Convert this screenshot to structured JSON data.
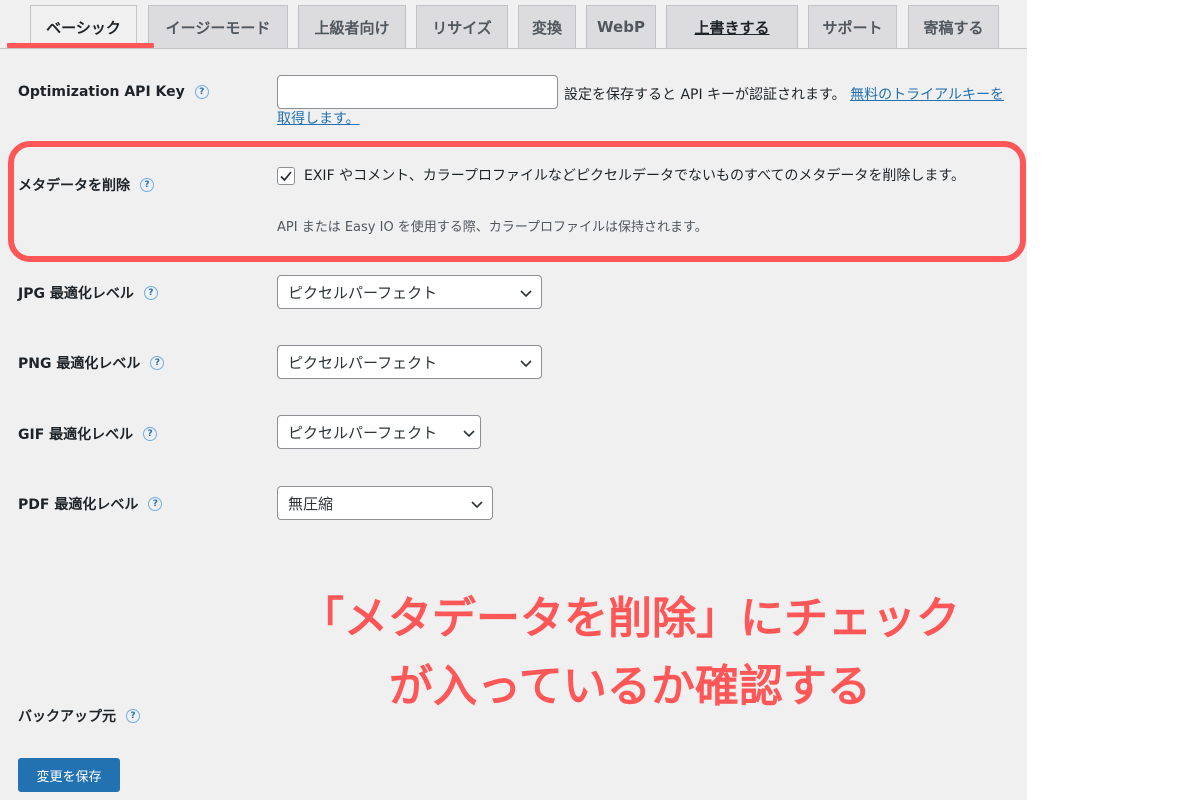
{
  "tabs": [
    {
      "label": "ベーシック"
    },
    {
      "label": "イージーモード"
    },
    {
      "label": "上級者向け"
    },
    {
      "label": "リサイズ"
    },
    {
      "label": "変換"
    },
    {
      "label": "WebP"
    },
    {
      "label": "上書きする"
    },
    {
      "label": "サポート"
    },
    {
      "label": "寄稿する"
    }
  ],
  "help_icon_glyph": "?",
  "api_key": {
    "label": "Optimization API Key",
    "value": "",
    "desc": "設定を保存すると API キーが認証されます。",
    "link": "無料のトライアルキーを取得します。"
  },
  "metadata": {
    "label": "メタデータを削除",
    "checked": true,
    "desc": "EXIF やコメント、カラープロファイルなどピクセルデータでないものすべてのメタデータを削除します。",
    "note": "API または Easy IO を使用する際、カラープロファイルは保持されます。"
  },
  "jpg": {
    "label": "JPG 最適化レベル",
    "value": "ピクセルパーフェクト"
  },
  "png": {
    "label": "PNG 最適化レベル",
    "value": "ピクセルパーフェクト"
  },
  "gif": {
    "label": "GIF 最適化レベル",
    "value": "ピクセルパーフェクト"
  },
  "pdf": {
    "label": "PDF 最適化レベル",
    "value": "無圧縮"
  },
  "backup": {
    "label": "バックアップ元"
  },
  "save_button": "変更を保存",
  "annotation": {
    "line1": "「メタデータを削除」にチェック",
    "line2": "が入っているか確認する"
  },
  "colors": {
    "highlight": "#ff5757",
    "primary_button": "#2271b1",
    "panel_bg": "#f0f0f1"
  }
}
